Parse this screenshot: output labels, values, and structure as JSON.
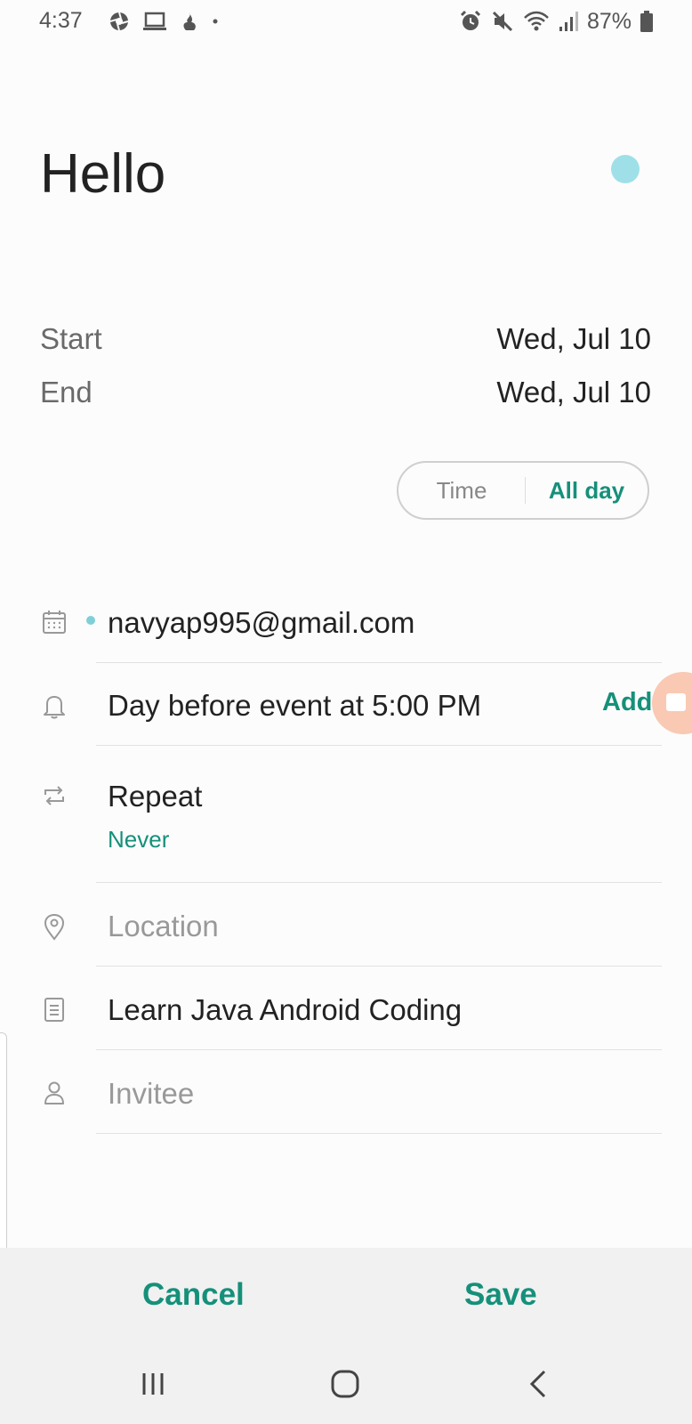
{
  "status_bar": {
    "time": "4:37",
    "battery_percent": "87%",
    "icons_left": [
      "aperture-icon",
      "laptop-icon",
      "fire-icon",
      "dot-icon"
    ],
    "icons_right": [
      "alarm-icon",
      "mute-icon",
      "wifi-icon",
      "signal-icon",
      "battery-icon"
    ]
  },
  "event": {
    "title": "Hello",
    "color": "#9fe0e8"
  },
  "dates": {
    "start_label": "Start",
    "start_value": "Wed, Jul 10",
    "end_label": "End",
    "end_value": "Wed, Jul 10"
  },
  "toggle": {
    "time_label": "Time",
    "allday_label": "All day",
    "selected": "All day"
  },
  "fields": {
    "calendar_account": "navyap995@gmail.com",
    "reminder": "Day before event at 5:00 PM",
    "reminder_add": "Add",
    "repeat_label": "Repeat",
    "repeat_value": "Never",
    "location_placeholder": "Location",
    "notes": "Learn Java Android Coding",
    "invitee_placeholder": "Invitee"
  },
  "actions": {
    "cancel": "Cancel",
    "save": "Save"
  },
  "nav_bar": {
    "icons": [
      "recent-apps-icon",
      "home-icon",
      "back-icon"
    ]
  },
  "colors": {
    "accent": "#15907a",
    "event_dot": "#9fe0e8",
    "floating_button": "#f9c9b3"
  }
}
